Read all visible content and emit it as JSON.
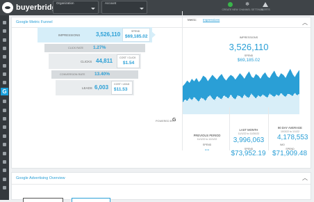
{
  "brand": {
    "name": "buyerbridge"
  },
  "topbar": {
    "organization_label": "Organization",
    "account_label": "Account",
    "create_label": "CREATE NEW",
    "channels_label": "CHANNEL SETTINGS",
    "alerts_label": "ALERTS"
  },
  "panel1": {
    "title": "Google Metric Funnel",
    "funnel": {
      "impressions": {
        "label": "IMPRESSIONS",
        "value": "3,526,110",
        "sub_label": "SPEND",
        "sub_value": "$69,185.02"
      },
      "ctr": {
        "label": "CLICK RATE",
        "value": "1.27%"
      },
      "clicks": {
        "label": "CLICKS",
        "value": "44,811",
        "sub_label": "COST / CLICK",
        "sub_value": "$1.54"
      },
      "cvr": {
        "label": "CONVERSION RATE",
        "value": "13.40%"
      },
      "leads": {
        "label": "LEADS",
        "value": "6,003",
        "sub_label": "COST / LEAD",
        "sub_value": "$11.53"
      }
    },
    "powered_by": "POWERED BY",
    "metric": {
      "label": "Metric:",
      "value": "Impressions",
      "big_label": "IMPRESSIONS",
      "big_value": "3,526,110",
      "spend_label": "SPEND",
      "spend_value": "$69,185.02"
    },
    "chart_data": {
      "type": "area",
      "series": [
        {
          "name": "",
          "values": [
            34,
            37,
            41,
            38,
            43,
            40,
            44,
            39,
            42,
            47,
            45,
            40,
            44,
            48,
            45,
            42,
            46,
            49,
            44,
            41,
            45,
            48,
            46,
            42,
            46,
            50,
            47,
            43,
            48,
            52,
            46,
            44,
            49,
            47,
            43,
            48,
            51,
            46,
            44,
            49,
            53,
            47,
            45,
            50,
            48,
            44,
            50,
            55,
            49,
            45,
            50,
            54
          ]
        },
        {
          "name": "",
          "values": [
            14,
            18,
            16,
            20,
            17,
            21,
            18,
            15,
            20,
            19,
            16,
            21,
            23,
            19,
            17,
            22,
            20,
            18,
            23,
            21,
            19,
            24,
            20,
            18,
            23,
            22,
            19,
            24,
            21,
            20,
            25,
            22,
            19,
            23,
            21,
            24,
            22,
            20,
            25,
            23,
            21,
            24,
            22,
            26,
            23,
            21,
            25,
            24,
            22,
            26,
            23,
            25
          ]
        }
      ],
      "grid": false
    },
    "stats": {
      "prev": {
        "title": "PREVIOUS PERIOD",
        "dates": "11/1/22 to 12/1/22",
        "spend_label": "SPEND",
        "spend_value": "--"
      },
      "last": {
        "title": "LAST MONTH",
        "dates": "11/1/22 to 11/30/22",
        "value": "3,996,063",
        "spend_label": "SPEND",
        "spend_value": "$73,952.19"
      },
      "avg": {
        "title": "90 DAY AVERAGE",
        "dates": "10/3/22 to 1/1/22",
        "value": "4,178,553",
        "unit": "/MO",
        "spend_label": "SPEND",
        "spend_value": "$71,909.48"
      }
    }
  },
  "panel2": {
    "title": "Google Advertising Overview"
  }
}
